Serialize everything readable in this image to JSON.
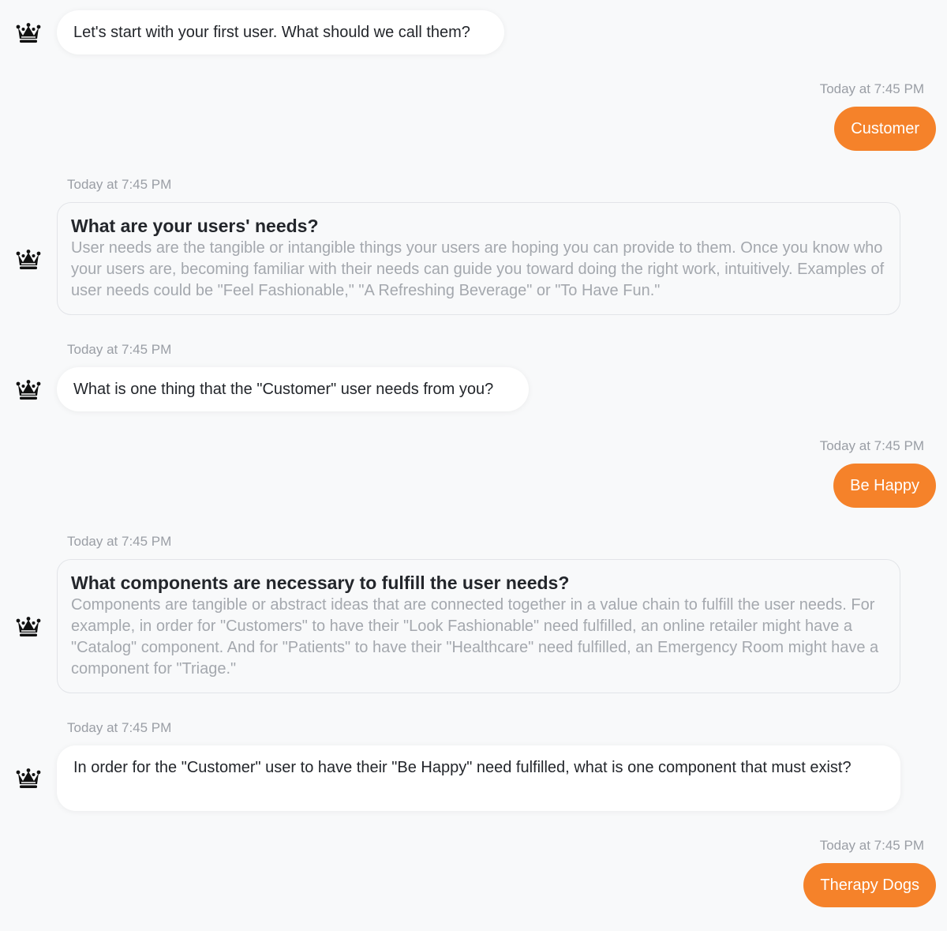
{
  "conversation": {
    "messages": [
      {
        "from": "bot",
        "text": "Let's start with your first user. What should we call them?"
      },
      {
        "from": "user",
        "time": "Today at 7:45 PM",
        "text": "Customer"
      },
      {
        "from": "bot",
        "time": "Today at 7:45 PM",
        "title": "What are your users' needs?",
        "text": "User needs are the tangible or intangible things your users are hoping you can provide to them. Once you know who your users are, becoming familiar with their needs can guide you toward doing the right work, intuitively. Examples of user needs could be \"Feel Fashionable,\" \"A Refreshing Beverage\" or \"To Have Fun.\""
      },
      {
        "from": "bot",
        "time": "Today at 7:45 PM",
        "text": "What is one thing that the \"Customer\" user needs from you?"
      },
      {
        "from": "user",
        "time": "Today at 7:45 PM",
        "text": "Be Happy"
      },
      {
        "from": "bot",
        "time": "Today at 7:45 PM",
        "title": "What components are necessary to fulfill the user needs?",
        "text": "Components are tangible or abstract ideas that are connected together in a value chain to fulfill the user needs. For example, in order for \"Customers\" to have their \"Look Fashionable\" need fulfilled, an online retailer might have a \"Catalog\" component. And for \"Patients\" to have their \"Healthcare\" need fulfilled, an Emergency Room might have a component for \"Triage.\""
      },
      {
        "from": "bot",
        "time": "Today at 7:45 PM",
        "text": "In order for the \"Customer\" user to have their \"Be Happy\" need fulfilled, what is one component that must exist?"
      },
      {
        "from": "user",
        "time": "Today at 7:45 PM",
        "text": "Therapy Dogs"
      }
    ]
  },
  "icons": {
    "bot_avatar": "crown-icon"
  },
  "colors": {
    "accent": "#f5822a",
    "background": "#f8f9fa",
    "bot_bubble": "#ffffff",
    "muted_text": "#a4a8ae"
  }
}
